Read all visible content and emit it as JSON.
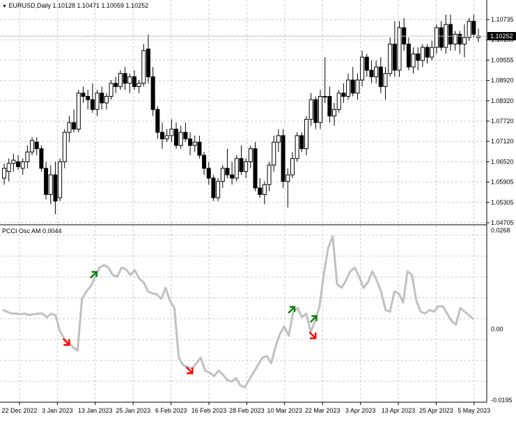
{
  "price_panel": {
    "dropdown_glyph": "▼",
    "header": "EURUSD,Daily  1.10128 1.10471 1.10059 1.10252",
    "price_labels": [
      "1.10735",
      "1.10155",
      "1.09555",
      "1.08920",
      "1.08320",
      "1.07720",
      "1.07120",
      "1.06520",
      "1.05905",
      "1.05305",
      "1.04705"
    ],
    "current_price": "1.10252"
  },
  "indicator_panel": {
    "header": "PCCI Osc AM 0.0044",
    "labels": [
      "0.0268",
      "0.00",
      "-0.0195"
    ]
  },
  "time_labels": [
    "22 Dec 2022",
    "3 Jan 2023",
    "13 Jan 2023",
    "25 Jan 2023",
    "6 Feb 2023",
    "16 Feb 2023",
    "28 Feb 2023",
    "10 Mar 2023",
    "22 Mar 2023",
    "3 Apr 2023",
    "13 Apr 2023",
    "25 Apr 2023",
    "5 May 2023"
  ],
  "colors": {
    "grid": "#c8c8c8",
    "bull": "#ffffff",
    "bear": "#000000",
    "osc_line": "#c0c0c0",
    "arrow_up": "#008000",
    "arrow_down": "#ff0000"
  },
  "chart_data": {
    "type": "candlestick",
    "symbol": "EURUSD",
    "timeframe": "Daily",
    "candles": [
      {
        "o": 1.059,
        "h": 1.0635,
        "l": 1.057,
        "c": 1.062
      },
      {
        "o": 1.061,
        "h": 1.065,
        "l": 1.058,
        "c": 1.0635
      },
      {
        "o": 1.0635,
        "h": 1.0665,
        "l": 1.061,
        "c": 1.0645
      },
      {
        "o": 1.064,
        "h": 1.066,
        "l": 1.0615,
        "c": 1.0625
      },
      {
        "o": 1.062,
        "h": 1.065,
        "l": 1.06,
        "c": 1.064
      },
      {
        "o": 1.064,
        "h": 1.069,
        "l": 1.062,
        "c": 1.067
      },
      {
        "o": 1.067,
        "h": 1.0715,
        "l": 1.066,
        "c": 1.0705
      },
      {
        "o": 1.07,
        "h": 1.0715,
        "l": 1.066,
        "c": 1.068
      },
      {
        "o": 1.068,
        "h": 1.069,
        "l": 1.061,
        "c": 1.062
      },
      {
        "o": 1.062,
        "h": 1.064,
        "l": 1.0525,
        "c": 1.054
      },
      {
        "o": 1.054,
        "h": 1.063,
        "l": 1.051,
        "c": 1.06
      },
      {
        "o": 1.06,
        "h": 1.064,
        "l": 1.048,
        "c": 1.052
      },
      {
        "o": 1.053,
        "h": 1.065,
        "l": 1.052,
        "c": 1.064
      },
      {
        "o": 1.064,
        "h": 1.074,
        "l": 1.062,
        "c": 1.073
      },
      {
        "o": 1.073,
        "h": 1.078,
        "l": 1.07,
        "c": 1.076
      },
      {
        "o": 1.076,
        "h": 1.08,
        "l": 1.073,
        "c": 1.074
      },
      {
        "o": 1.074,
        "h": 1.086,
        "l": 1.073,
        "c": 1.085
      },
      {
        "o": 1.085,
        "h": 1.087,
        "l": 1.082,
        "c": 1.084
      },
      {
        "o": 1.084,
        "h": 1.086,
        "l": 1.08,
        "c": 1.083
      },
      {
        "o": 1.083,
        "h": 1.088,
        "l": 1.079,
        "c": 1.08
      },
      {
        "o": 1.08,
        "h": 1.086,
        "l": 1.078,
        "c": 1.085
      },
      {
        "o": 1.085,
        "h": 1.087,
        "l": 1.08,
        "c": 1.082
      },
      {
        "o": 1.082,
        "h": 1.085,
        "l": 1.08,
        "c": 1.084
      },
      {
        "o": 1.084,
        "h": 1.089,
        "l": 1.083,
        "c": 1.088
      },
      {
        "o": 1.088,
        "h": 1.09,
        "l": 1.085,
        "c": 1.087
      },
      {
        "o": 1.087,
        "h": 1.092,
        "l": 1.086,
        "c": 1.091
      },
      {
        "o": 1.091,
        "h": 1.093,
        "l": 1.086,
        "c": 1.088
      },
      {
        "o": 1.088,
        "h": 1.091,
        "l": 1.085,
        "c": 1.09
      },
      {
        "o": 1.09,
        "h": 1.092,
        "l": 1.086,
        "c": 1.087
      },
      {
        "o": 1.087,
        "h": 1.089,
        "l": 1.085,
        "c": 1.088
      },
      {
        "o": 1.088,
        "h": 1.1,
        "l": 1.087,
        "c": 1.098
      },
      {
        "o": 1.0985,
        "h": 1.103,
        "l": 1.088,
        "c": 1.09
      },
      {
        "o": 1.09,
        "h": 1.093,
        "l": 1.078,
        "c": 1.08
      },
      {
        "o": 1.08,
        "h": 1.081,
        "l": 1.071,
        "c": 1.073
      },
      {
        "o": 1.073,
        "h": 1.076,
        "l": 1.068,
        "c": 1.071
      },
      {
        "o": 1.071,
        "h": 1.074,
        "l": 1.07,
        "c": 1.072
      },
      {
        "o": 1.072,
        "h": 1.077,
        "l": 1.07,
        "c": 1.074
      },
      {
        "o": 1.074,
        "h": 1.076,
        "l": 1.068,
        "c": 1.069
      },
      {
        "o": 1.069,
        "h": 1.075,
        "l": 1.068,
        "c": 1.073
      },
      {
        "o": 1.073,
        "h": 1.076,
        "l": 1.07,
        "c": 1.071
      },
      {
        "o": 1.071,
        "h": 1.073,
        "l": 1.066,
        "c": 1.069
      },
      {
        "o": 1.069,
        "h": 1.072,
        "l": 1.067,
        "c": 1.07
      },
      {
        "o": 1.07,
        "h": 1.072,
        "l": 1.065,
        "c": 1.066
      },
      {
        "o": 1.066,
        "h": 1.067,
        "l": 1.06,
        "c": 1.062
      },
      {
        "o": 1.062,
        "h": 1.064,
        "l": 1.057,
        "c": 1.059
      },
      {
        "o": 1.059,
        "h": 1.06,
        "l": 1.052,
        "c": 1.053
      },
      {
        "o": 1.053,
        "h": 1.059,
        "l": 1.052,
        "c": 1.058
      },
      {
        "o": 1.058,
        "h": 1.063,
        "l": 1.056,
        "c": 1.062
      },
      {
        "o": 1.062,
        "h": 1.068,
        "l": 1.059,
        "c": 1.06
      },
      {
        "o": 1.06,
        "h": 1.064,
        "l": 1.057,
        "c": 1.059
      },
      {
        "o": 1.059,
        "h": 1.066,
        "l": 1.058,
        "c": 1.065
      },
      {
        "o": 1.065,
        "h": 1.069,
        "l": 1.06,
        "c": 1.061
      },
      {
        "o": 1.061,
        "h": 1.065,
        "l": 1.059,
        "c": 1.064
      },
      {
        "o": 1.064,
        "h": 1.069,
        "l": 1.062,
        "c": 1.068
      },
      {
        "o": 1.068,
        "h": 1.07,
        "l": 1.055,
        "c": 1.056
      },
      {
        "o": 1.056,
        "h": 1.059,
        "l": 1.053,
        "c": 1.054
      },
      {
        "o": 1.054,
        "h": 1.058,
        "l": 1.051,
        "c": 1.057
      },
      {
        "o": 1.057,
        "h": 1.064,
        "l": 1.055,
        "c": 1.063
      },
      {
        "o": 1.063,
        "h": 1.072,
        "l": 1.061,
        "c": 1.07
      },
      {
        "o": 1.07,
        "h": 1.074,
        "l": 1.067,
        "c": 1.072
      },
      {
        "o": 1.072,
        "h": 1.074,
        "l": 1.056,
        "c": 1.058
      },
      {
        "o": 1.058,
        "h": 1.062,
        "l": 1.05,
        "c": 1.06
      },
      {
        "o": 1.06,
        "h": 1.067,
        "l": 1.059,
        "c": 1.065
      },
      {
        "o": 1.065,
        "h": 1.073,
        "l": 1.064,
        "c": 1.072
      },
      {
        "o": 1.072,
        "h": 1.073,
        "l": 1.067,
        "c": 1.068
      },
      {
        "o": 1.068,
        "h": 1.078,
        "l": 1.066,
        "c": 1.077
      },
      {
        "o": 1.077,
        "h": 1.085,
        "l": 1.075,
        "c": 1.083
      },
      {
        "o": 1.083,
        "h": 1.084,
        "l": 1.074,
        "c": 1.076
      },
      {
        "o": 1.076,
        "h": 1.086,
        "l": 1.074,
        "c": 1.084
      },
      {
        "o": 1.084,
        "h": 1.096,
        "l": 1.082,
        "c": 1.084
      },
      {
        "o": 1.084,
        "h": 1.087,
        "l": 1.076,
        "c": 1.078
      },
      {
        "o": 1.078,
        "h": 1.082,
        "l": 1.075,
        "c": 1.08
      },
      {
        "o": 1.08,
        "h": 1.086,
        "l": 1.079,
        "c": 1.085
      },
      {
        "o": 1.085,
        "h": 1.088,
        "l": 1.082,
        "c": 1.084
      },
      {
        "o": 1.084,
        "h": 1.091,
        "l": 1.083,
        "c": 1.089
      },
      {
        "o": 1.089,
        "h": 1.093,
        "l": 1.084,
        "c": 1.085
      },
      {
        "o": 1.085,
        "h": 1.091,
        "l": 1.083,
        "c": 1.089
      },
      {
        "o": 1.089,
        "h": 1.098,
        "l": 1.087,
        "c": 1.096
      },
      {
        "o": 1.096,
        "h": 1.097,
        "l": 1.09,
        "c": 1.092
      },
      {
        "o": 1.092,
        "h": 1.095,
        "l": 1.088,
        "c": 1.09
      },
      {
        "o": 1.09,
        "h": 1.095,
        "l": 1.088,
        "c": 1.093
      },
      {
        "o": 1.093,
        "h": 1.096,
        "l": 1.085,
        "c": 1.087
      },
      {
        "o": 1.087,
        "h": 1.093,
        "l": 1.083,
        "c": 1.091
      },
      {
        "o": 1.091,
        "h": 1.102,
        "l": 1.09,
        "c": 1.1
      },
      {
        "o": 1.1,
        "h": 1.107,
        "l": 1.09,
        "c": 1.092
      },
      {
        "o": 1.092,
        "h": 1.107,
        "l": 1.09,
        "c": 1.105
      },
      {
        "o": 1.105,
        "h": 1.108,
        "l": 1.098,
        "c": 1.1
      },
      {
        "o": 1.1,
        "h": 1.102,
        "l": 1.092,
        "c": 1.093
      },
      {
        "o": 1.093,
        "h": 1.099,
        "l": 1.091,
        "c": 1.097
      },
      {
        "o": 1.097,
        "h": 1.099,
        "l": 1.092,
        "c": 1.095
      },
      {
        "o": 1.095,
        "h": 1.1,
        "l": 1.093,
        "c": 1.099
      },
      {
        "o": 1.099,
        "h": 1.1,
        "l": 1.094,
        "c": 1.096
      },
      {
        "o": 1.096,
        "h": 1.101,
        "l": 1.095,
        "c": 1.099
      },
      {
        "o": 1.099,
        "h": 1.106,
        "l": 1.097,
        "c": 1.105
      },
      {
        "o": 1.105,
        "h": 1.107,
        "l": 1.098,
        "c": 1.099
      },
      {
        "o": 1.099,
        "h": 1.109,
        "l": 1.097,
        "c": 1.106
      },
      {
        "o": 1.106,
        "h": 1.109,
        "l": 1.098,
        "c": 1.1
      },
      {
        "o": 1.1,
        "h": 1.104,
        "l": 1.098,
        "c": 1.103
      },
      {
        "o": 1.103,
        "h": 1.104,
        "l": 1.097,
        "c": 1.1
      },
      {
        "o": 1.1,
        "h": 1.106,
        "l": 1.096,
        "c": 1.102
      },
      {
        "o": 1.102,
        "h": 1.108,
        "l": 1.101,
        "c": 1.107
      },
      {
        "o": 1.107,
        "h": 1.109,
        "l": 1.102,
        "c": 1.103
      },
      {
        "o": 1.102,
        "h": 1.1047,
        "l": 1.1006,
        "c": 1.1025
      }
    ],
    "oscillator": [
      0.005,
      0.0045,
      0.004,
      0.004,
      0.0038,
      0.004,
      0.0036,
      0.0038,
      0.004,
      0.004,
      0.003,
      0.004,
      0.0035,
      -0.0008,
      -0.0028,
      -0.0038,
      -0.0052,
      -0.006,
      0.008,
      0.01,
      0.0115,
      0.014,
      0.0165,
      0.0172,
      0.0165,
      0.0145,
      0.014,
      0.0165,
      0.016,
      0.0145,
      0.0158,
      0.0135,
      0.0125,
      0.01,
      0.0095,
      0.0092,
      0.008,
      0.011,
      0.0075,
      0.0055,
      -0.008,
      -0.01,
      -0.0105,
      -0.011,
      -0.0095,
      -0.008,
      -0.0115,
      -0.012,
      -0.013,
      -0.0115,
      -0.0125,
      -0.014,
      -0.0145,
      -0.0135,
      -0.0155,
      -0.016,
      -0.014,
      -0.012,
      -0.01,
      -0.008,
      -0.0075,
      -0.0095,
      -0.005,
      -0.0015,
      0.0005,
      -0.002,
      0.0045,
      0.0055,
      0.003,
      0.004,
      -0.001,
      0.002,
      0.006,
      0.015,
      0.022,
      0.025,
      0.012,
      0.011,
      0.013,
      0.0155,
      0.0165,
      0.014,
      0.011,
      0.0125,
      0.0155,
      0.013,
      0.01,
      0.005,
      0.0045,
      0.01,
      0.0095,
      0.007,
      0.0155,
      0.0145,
      0.0075,
      0.0045,
      0.004,
      0.005,
      0.0045,
      0.006,
      0.006,
      0.004,
      0.002,
      0.001,
      0.0055,
      0.0045,
      0.0035,
      0.0025
    ],
    "signals": [
      {
        "i": 14,
        "dir": "down"
      },
      {
        "i": 21,
        "dir": "up"
      },
      {
        "i": 42,
        "dir": "down"
      },
      {
        "i": 66,
        "dir": "up"
      },
      {
        "i": 70,
        "dir": "down"
      },
      {
        "i": 71,
        "dir": "up"
      }
    ],
    "price_range": [
      1.0458,
      1.1105
    ],
    "osc_range": [
      -0.0195,
      0.0268
    ]
  }
}
